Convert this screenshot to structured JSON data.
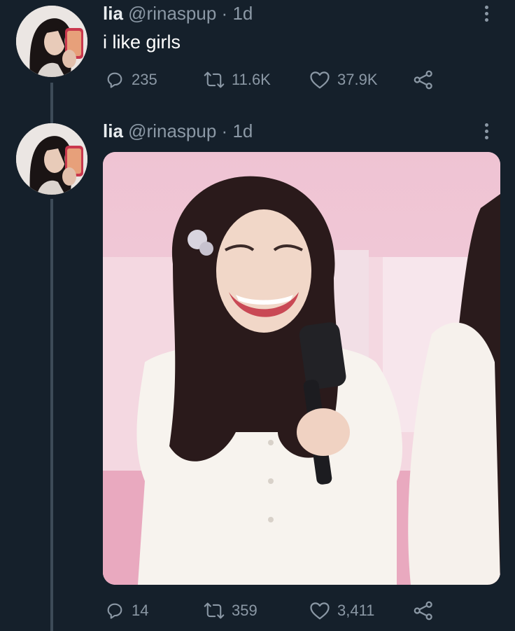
{
  "tweets": [
    {
      "name": "lia",
      "handle": "@rinaspup",
      "dot": "·",
      "time": "1d",
      "text": "i like girls",
      "replies": "235",
      "retweets": "11.6K",
      "likes": "37.9K"
    },
    {
      "name": "lia",
      "handle": "@rinaspup",
      "dot": "·",
      "time": "1d",
      "text": "",
      "replies": "14",
      "retweets": "359",
      "likes": "3,411"
    }
  ],
  "icons": {
    "reply": "reply-icon",
    "retweet": "retweet-icon",
    "like": "heart-icon",
    "share": "share-icon",
    "more": "more-options-icon"
  },
  "colors": {
    "background": "#15202b",
    "muted": "#8b98a5",
    "thread_line": "#3d4b58"
  }
}
